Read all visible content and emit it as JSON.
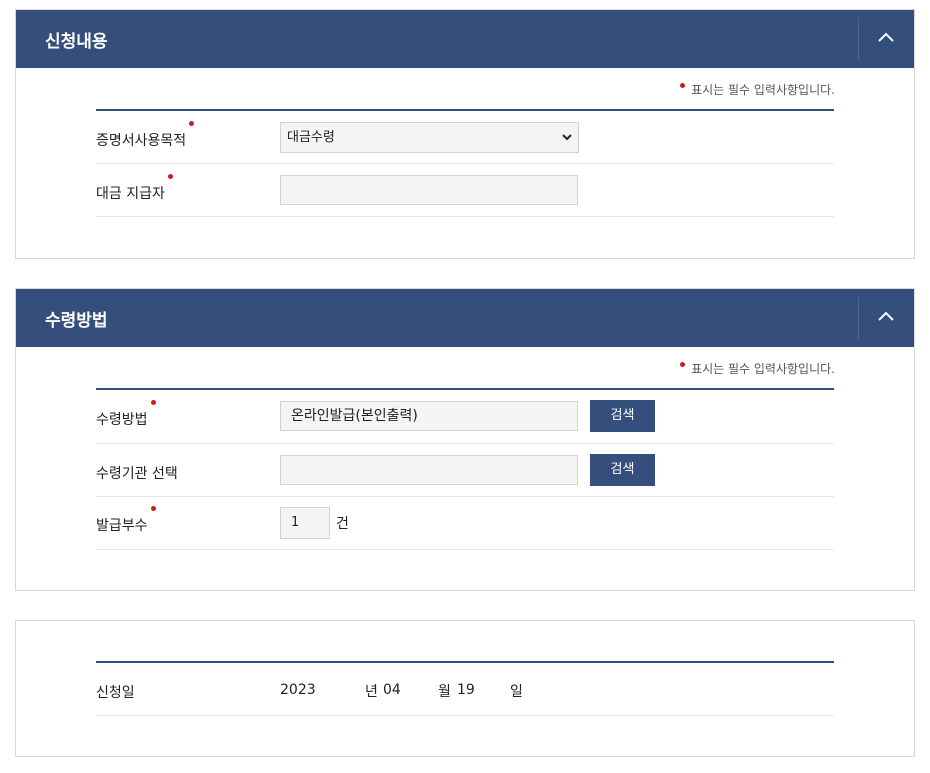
{
  "required_note": "표시는 필수 입력사항입니다.",
  "section1": {
    "title": "신청내용",
    "purpose_label": "증명서사용목적",
    "purpose_value": "대금수령",
    "payer_label": "대금 지급자",
    "payer_value": ""
  },
  "section2": {
    "title": "수령방법",
    "method_label": "수령방법",
    "method_value": "온라인발급(본인출력)",
    "search_label": "검색",
    "agency_label": "수령기관 선택",
    "agency_value": "",
    "copies_label": "발급부수",
    "copies_value": "1",
    "copies_unit": "건"
  },
  "section3": {
    "date_label": "신청일",
    "year": "2023",
    "year_unit": "년",
    "month": "04",
    "month_unit": "월",
    "day": "19",
    "day_unit": "일"
  }
}
